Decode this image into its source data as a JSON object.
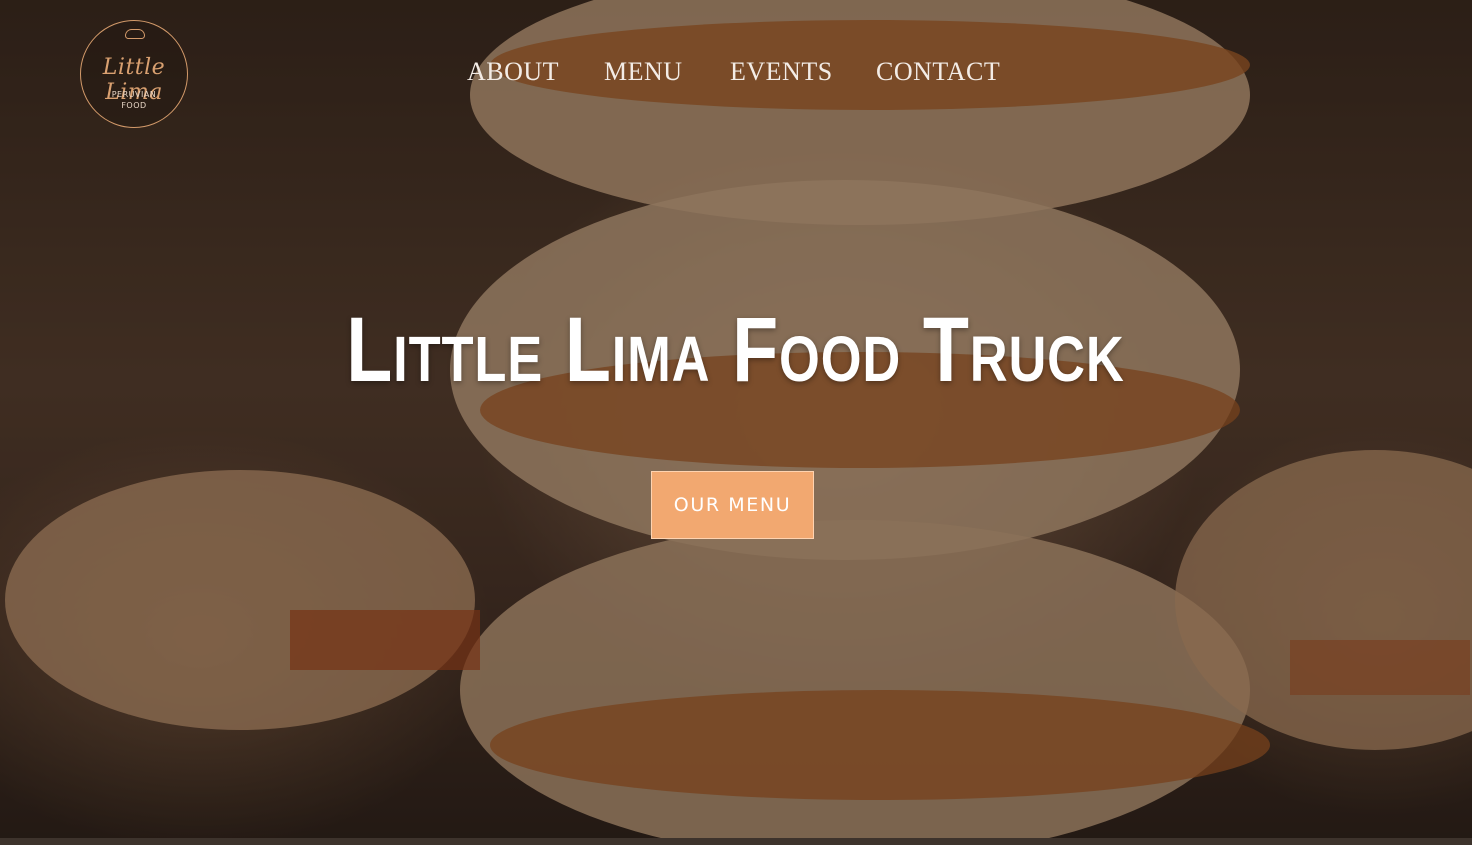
{
  "brand": {
    "logo_script": "Little Lima",
    "logo_line1": "PERUVIAN",
    "logo_line2": "FOOD"
  },
  "nav": {
    "items": [
      {
        "label": "ABOUT"
      },
      {
        "label": "MENU"
      },
      {
        "label": "EVENTS"
      },
      {
        "label": "CONTACT"
      }
    ]
  },
  "hero": {
    "title": "Little Lima Food Truck",
    "cta_label": "OUR MENU",
    "image_subject": "alfajores-cookies-photo"
  },
  "colors": {
    "accent": "#f2a870",
    "logo_accent": "#d39a6a",
    "nav_text": "#f3ece6",
    "title_text": "#ffffff"
  }
}
